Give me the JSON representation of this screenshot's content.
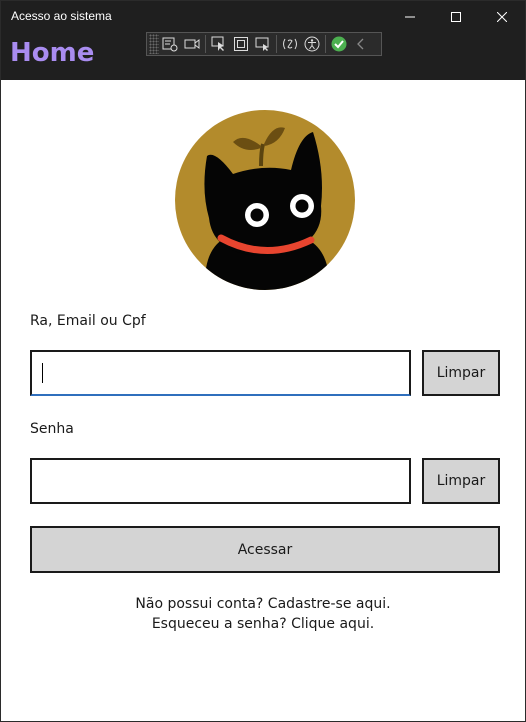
{
  "window": {
    "title": "Acesso ao sistema"
  },
  "appbar": {
    "title": "Home"
  },
  "devtools": {
    "icons": [
      "select-element-icon",
      "record-icon",
      "pointer-icon",
      "frame-icon",
      "layout-icon",
      "hot-reload-icon",
      "accessibility-icon",
      "check-ok-icon",
      "collapse-icon"
    ]
  },
  "form": {
    "user_label": "Ra, Email ou Cpf",
    "user_value": "",
    "user_clear": "Limpar",
    "password_label": "Senha",
    "password_value": "",
    "password_clear": "Limpar",
    "submit": "Acessar",
    "signup_link": "Não possui conta? Cadastre-se aqui.",
    "forgot_link": "Esqueceu a senha? Clique aqui."
  },
  "colors": {
    "accent": "#a98cf0",
    "titlebar": "#1f1f1f",
    "avatar_bg": "#b38b2c",
    "collar": "#e8452f"
  }
}
